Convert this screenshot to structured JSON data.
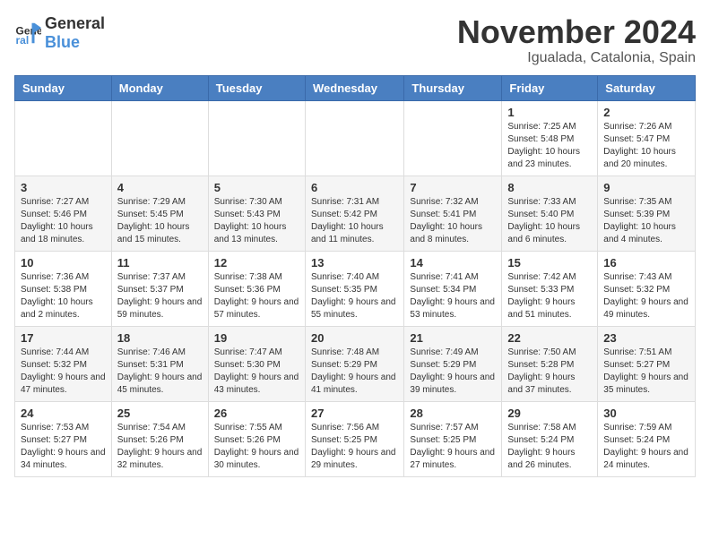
{
  "logo": {
    "text_general": "General",
    "text_blue": "Blue"
  },
  "header": {
    "month": "November 2024",
    "location": "Igualada, Catalonia, Spain"
  },
  "weekdays": [
    "Sunday",
    "Monday",
    "Tuesday",
    "Wednesday",
    "Thursday",
    "Friday",
    "Saturday"
  ],
  "weeks": [
    [
      {
        "day": "",
        "info": ""
      },
      {
        "day": "",
        "info": ""
      },
      {
        "day": "",
        "info": ""
      },
      {
        "day": "",
        "info": ""
      },
      {
        "day": "",
        "info": ""
      },
      {
        "day": "1",
        "info": "Sunrise: 7:25 AM\nSunset: 5:48 PM\nDaylight: 10 hours and 23 minutes."
      },
      {
        "day": "2",
        "info": "Sunrise: 7:26 AM\nSunset: 5:47 PM\nDaylight: 10 hours and 20 minutes."
      }
    ],
    [
      {
        "day": "3",
        "info": "Sunrise: 7:27 AM\nSunset: 5:46 PM\nDaylight: 10 hours and 18 minutes."
      },
      {
        "day": "4",
        "info": "Sunrise: 7:29 AM\nSunset: 5:45 PM\nDaylight: 10 hours and 15 minutes."
      },
      {
        "day": "5",
        "info": "Sunrise: 7:30 AM\nSunset: 5:43 PM\nDaylight: 10 hours and 13 minutes."
      },
      {
        "day": "6",
        "info": "Sunrise: 7:31 AM\nSunset: 5:42 PM\nDaylight: 10 hours and 11 minutes."
      },
      {
        "day": "7",
        "info": "Sunrise: 7:32 AM\nSunset: 5:41 PM\nDaylight: 10 hours and 8 minutes."
      },
      {
        "day": "8",
        "info": "Sunrise: 7:33 AM\nSunset: 5:40 PM\nDaylight: 10 hours and 6 minutes."
      },
      {
        "day": "9",
        "info": "Sunrise: 7:35 AM\nSunset: 5:39 PM\nDaylight: 10 hours and 4 minutes."
      }
    ],
    [
      {
        "day": "10",
        "info": "Sunrise: 7:36 AM\nSunset: 5:38 PM\nDaylight: 10 hours and 2 minutes."
      },
      {
        "day": "11",
        "info": "Sunrise: 7:37 AM\nSunset: 5:37 PM\nDaylight: 9 hours and 59 minutes."
      },
      {
        "day": "12",
        "info": "Sunrise: 7:38 AM\nSunset: 5:36 PM\nDaylight: 9 hours and 57 minutes."
      },
      {
        "day": "13",
        "info": "Sunrise: 7:40 AM\nSunset: 5:35 PM\nDaylight: 9 hours and 55 minutes."
      },
      {
        "day": "14",
        "info": "Sunrise: 7:41 AM\nSunset: 5:34 PM\nDaylight: 9 hours and 53 minutes."
      },
      {
        "day": "15",
        "info": "Sunrise: 7:42 AM\nSunset: 5:33 PM\nDaylight: 9 hours and 51 minutes."
      },
      {
        "day": "16",
        "info": "Sunrise: 7:43 AM\nSunset: 5:32 PM\nDaylight: 9 hours and 49 minutes."
      }
    ],
    [
      {
        "day": "17",
        "info": "Sunrise: 7:44 AM\nSunset: 5:32 PM\nDaylight: 9 hours and 47 minutes."
      },
      {
        "day": "18",
        "info": "Sunrise: 7:46 AM\nSunset: 5:31 PM\nDaylight: 9 hours and 45 minutes."
      },
      {
        "day": "19",
        "info": "Sunrise: 7:47 AM\nSunset: 5:30 PM\nDaylight: 9 hours and 43 minutes."
      },
      {
        "day": "20",
        "info": "Sunrise: 7:48 AM\nSunset: 5:29 PM\nDaylight: 9 hours and 41 minutes."
      },
      {
        "day": "21",
        "info": "Sunrise: 7:49 AM\nSunset: 5:29 PM\nDaylight: 9 hours and 39 minutes."
      },
      {
        "day": "22",
        "info": "Sunrise: 7:50 AM\nSunset: 5:28 PM\nDaylight: 9 hours and 37 minutes."
      },
      {
        "day": "23",
        "info": "Sunrise: 7:51 AM\nSunset: 5:27 PM\nDaylight: 9 hours and 35 minutes."
      }
    ],
    [
      {
        "day": "24",
        "info": "Sunrise: 7:53 AM\nSunset: 5:27 PM\nDaylight: 9 hours and 34 minutes."
      },
      {
        "day": "25",
        "info": "Sunrise: 7:54 AM\nSunset: 5:26 PM\nDaylight: 9 hours and 32 minutes."
      },
      {
        "day": "26",
        "info": "Sunrise: 7:55 AM\nSunset: 5:26 PM\nDaylight: 9 hours and 30 minutes."
      },
      {
        "day": "27",
        "info": "Sunrise: 7:56 AM\nSunset: 5:25 PM\nDaylight: 9 hours and 29 minutes."
      },
      {
        "day": "28",
        "info": "Sunrise: 7:57 AM\nSunset: 5:25 PM\nDaylight: 9 hours and 27 minutes."
      },
      {
        "day": "29",
        "info": "Sunrise: 7:58 AM\nSunset: 5:24 PM\nDaylight: 9 hours and 26 minutes."
      },
      {
        "day": "30",
        "info": "Sunrise: 7:59 AM\nSunset: 5:24 PM\nDaylight: 9 hours and 24 minutes."
      }
    ]
  ]
}
